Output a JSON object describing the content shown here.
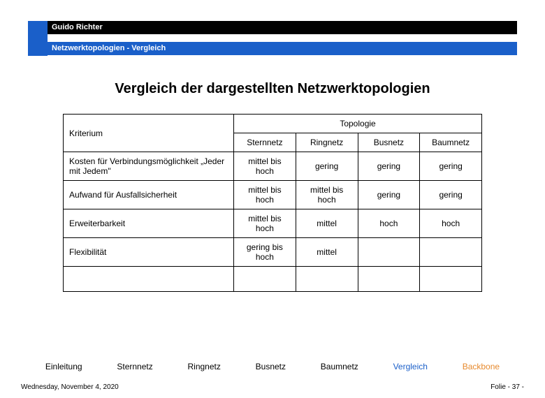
{
  "header": {
    "author": "Guido Richter",
    "topic": "Netzwerktopologien  - Vergleich"
  },
  "title": "Vergleich der dargestellten Netzwerktopologien",
  "table": {
    "criterion_label": "Kriterium",
    "topology_label": "Topologie",
    "columns": [
      "Sternnetz",
      "Ringnetz",
      "Busnetz",
      "Baumnetz"
    ],
    "rows": [
      {
        "label": "Kosten für Verbindungsmöglichkeit „Jeder mit Jedem\"",
        "values": [
          "mittel bis hoch",
          "gering",
          "gering",
          "gering"
        ]
      },
      {
        "label": "Aufwand für Ausfallsicherheit",
        "values": [
          "mittel bis hoch",
          "mittel bis hoch",
          "gering",
          "gering"
        ]
      },
      {
        "label": "Erweiterbarkeit",
        "values": [
          "mittel bis hoch",
          "mittel",
          "hoch",
          "hoch"
        ]
      },
      {
        "label": "Flexibilität",
        "values": [
          "gering bis hoch",
          "mittel",
          "",
          ""
        ]
      }
    ]
  },
  "nav": {
    "items": [
      "Einleitung",
      "Sternnetz",
      "Ringnetz",
      "Busnetz",
      "Baumnetz",
      "Vergleich",
      "Backbone"
    ]
  },
  "footer": {
    "date": "Wednesday, November 4, 2020",
    "page_prefix": "Folie - ",
    "page_num": "37",
    "page_suffix": " -"
  }
}
